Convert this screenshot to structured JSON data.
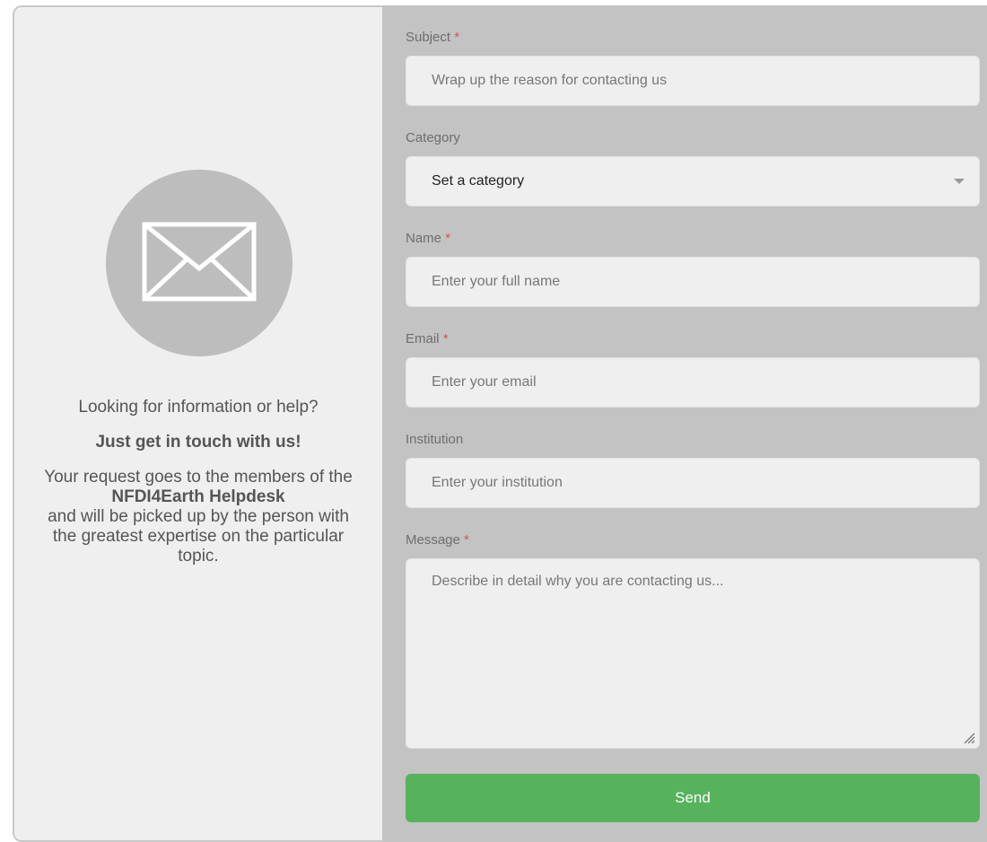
{
  "info_panel": {
    "lead": "Looking for information or help?",
    "cta": "Just get in touch with us!",
    "body_before": "Your request goes to the members of the",
    "org": "NFDI4Earth Helpdesk",
    "body_after": "and will be picked up by the person with the greatest expertise on the particular topic.",
    "icon": "envelope-icon"
  },
  "form": {
    "subject": {
      "label": "Subject",
      "required_mark": "*",
      "placeholder": "Wrap up the reason for contacting us"
    },
    "category": {
      "label": "Category",
      "selected": "Set a category"
    },
    "name": {
      "label": "Name",
      "required_mark": "*",
      "placeholder": "Enter your full name"
    },
    "email": {
      "label": "Email",
      "required_mark": "*",
      "placeholder": "Enter your email"
    },
    "institution": {
      "label": "Institution",
      "placeholder": "Enter your institution"
    },
    "message": {
      "label": "Message",
      "required_mark": "*",
      "placeholder": "Describe in detail why you are contacting us..."
    },
    "send_label": "Send"
  },
  "colors": {
    "accent_send": "#56b35c",
    "required": "#d9534f",
    "form_background": "#c3c3c3",
    "info_background": "#efefef"
  }
}
